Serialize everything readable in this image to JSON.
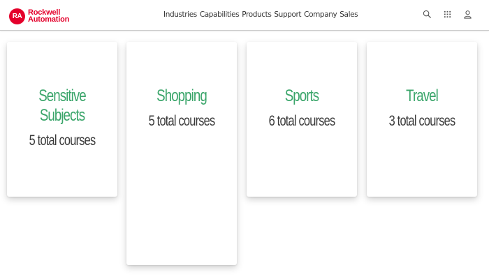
{
  "brand": {
    "mark": "RA",
    "line1": "Rockwell",
    "line2": "Automation",
    "color": "#e4002b"
  },
  "nav": {
    "items": [
      "Industries",
      "Capabilities",
      "Products",
      "Support",
      "Company",
      "Sales"
    ]
  },
  "header_icons": [
    "search-icon",
    "apps-grid-icon",
    "user-icon"
  ],
  "accent_color": "#3aa56a",
  "cards": [
    {
      "title": "Sensitive Subjects",
      "count": "5 total courses"
    },
    {
      "title": "Shopping",
      "count": "5 total courses"
    },
    {
      "title": "Sports",
      "count": "6 total courses"
    },
    {
      "title": "Travel",
      "count": "3 total courses"
    }
  ]
}
